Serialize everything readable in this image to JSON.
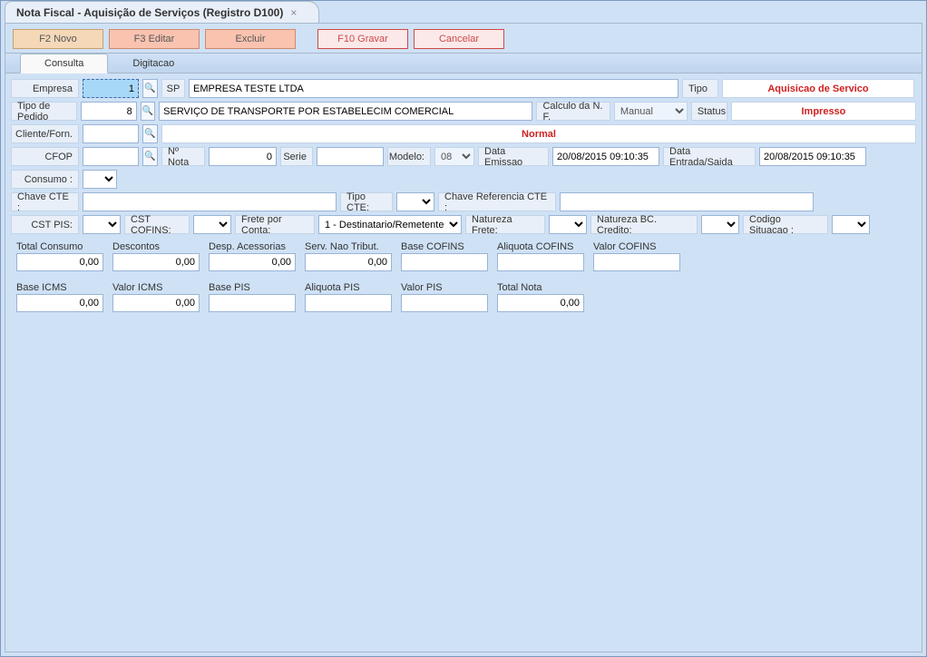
{
  "window": {
    "title": "Nota Fiscal - Aquisição de Serviços (Registro D100)"
  },
  "toolbar": {
    "novo": "F2 Novo",
    "editar": "F3 Editar",
    "excluir": "Excluir",
    "gravar": "F10 Gravar",
    "cancelar": "Cancelar"
  },
  "tabs": {
    "consulta": "Consulta",
    "digitacao": "Digitacao"
  },
  "labels": {
    "empresa": "Empresa",
    "tipo": "Tipo",
    "tipo_pedido": "Tipo de Pedido",
    "calculo_nf": "Calculo da N. F.",
    "status": "Status",
    "cliente_forn": "Cliente/Forn.",
    "cfop": "CFOP",
    "num_nota": "Nº Nota",
    "serie": "Serie",
    "modelo": "Modelo:",
    "data_emissao": "Data Emissao",
    "data_entrada": "Data Entrada/Saida",
    "consumo": "Consumo :",
    "chave_cte": "Chave CTE :",
    "tipo_cte": "Tipo CTE:",
    "chave_ref_cte": "Chave Referencia CTE :",
    "cst_pis": "CST PIS:",
    "cst_cofins": "CST COFINS:",
    "frete_conta": "Frete por Conta:",
    "natureza_frete": "Natureza Frete:",
    "natureza_bc": "Natureza BC. Credito:",
    "codigo_situacao": "Codigo Situacao :"
  },
  "values": {
    "empresa_id": "1",
    "empresa_uf": "SP",
    "empresa_nome": "EMPRESA TESTE LTDA",
    "tipo_box": "Aquisicao de Servico",
    "tipo_pedido_id": "8",
    "tipo_pedido_desc": "SERVIÇO DE TRANSPORTE POR ESTABELECIM COMERCIAL",
    "calculo_nf": "Manual",
    "status_box": "Impresso",
    "cliente_forn": "",
    "cliente_forn_label": "Normal",
    "cfop": "",
    "num_nota": "0",
    "serie": "",
    "modelo": "08",
    "data_emissao": "20/08/2015 09:10:35",
    "data_entrada": "20/08/2015 09:10:35",
    "consumo": "",
    "chave_cte": "",
    "tipo_cte": "",
    "chave_ref_cte": "",
    "cst_pis": "",
    "cst_cofins": "",
    "frete_conta": "1 - Destinatario/Remetente",
    "natureza_frete": "",
    "natureza_bc": "",
    "codigo_situacao": ""
  },
  "totals": {
    "total_consumo": {
      "label": "Total Consumo",
      "value": "0,00"
    },
    "descontos": {
      "label": "Descontos",
      "value": "0,00"
    },
    "desp_acessorias": {
      "label": "Desp. Acessorias",
      "value": "0,00"
    },
    "serv_nao_tribut": {
      "label": "Serv. Nao Tribut.",
      "value": "0,00"
    },
    "base_cofins": {
      "label": "Base COFINS",
      "value": ""
    },
    "aliquota_cofins": {
      "label": "Aliquota COFINS",
      "value": ""
    },
    "valor_cofins": {
      "label": "Valor COFINS",
      "value": ""
    },
    "base_icms": {
      "label": "Base ICMS",
      "value": "0,00"
    },
    "valor_icms": {
      "label": "Valor ICMS",
      "value": "0,00"
    },
    "base_pis": {
      "label": "Base PIS",
      "value": ""
    },
    "aliquota_pis": {
      "label": "Aliquota PIS",
      "value": ""
    },
    "valor_pis": {
      "label": "Valor PIS",
      "value": ""
    },
    "total_nota": {
      "label": "Total Nota",
      "value": "0,00"
    }
  }
}
